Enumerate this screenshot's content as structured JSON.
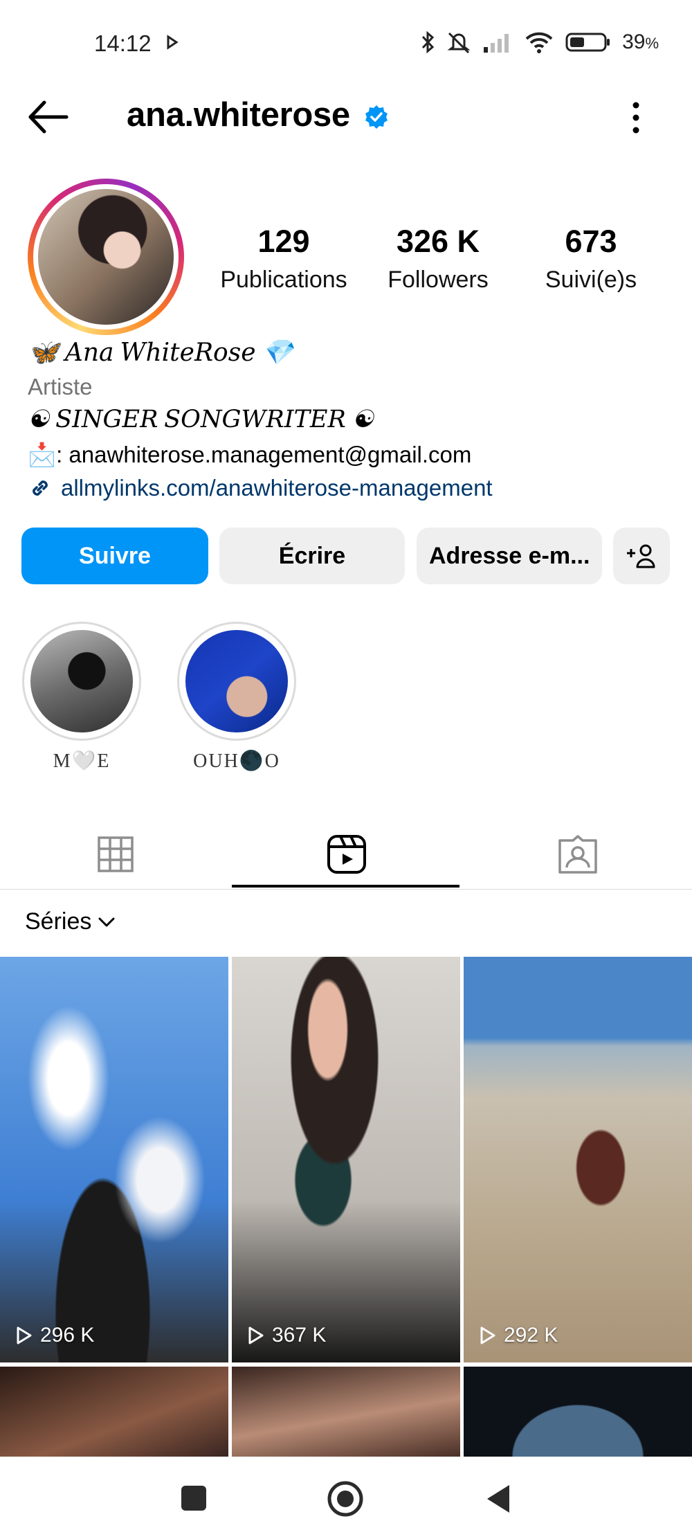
{
  "status_bar": {
    "time": "14:12",
    "battery_percent": "39",
    "battery_unit": "%",
    "icons": [
      "play-icon",
      "bluetooth-icon",
      "mute-icon",
      "signal-icon",
      "wifi-icon",
      "battery-icon"
    ]
  },
  "header": {
    "username": "ana.whiterose",
    "verified": true,
    "back_icon": "arrow-left-icon",
    "more_icon": "more-vertical-icon"
  },
  "stats": {
    "posts_count": "129",
    "posts_label": "Publications",
    "followers_count": "326 K",
    "followers_label": "Followers",
    "following_count": "673",
    "following_label": "Suivi(e)s"
  },
  "bio": {
    "name": "🦋 𝐴𝑛𝑎 𝑊ℎ𝑖𝑡𝑒𝑅𝑜𝑠𝑒 💎",
    "category": "Artiste",
    "line": "☯ 𝑆𝐼𝑁𝐺𝐸𝑅 𝑆𝑂𝑁𝐺𝑊𝑅𝐼𝑇𝐸𝑅 ☯",
    "email_line": "📩: anawhiterose.management@gmail.com",
    "link": "allmylinks.com/anawhiterose-management"
  },
  "actions": {
    "follow_label": "Suivre",
    "message_label": "Écrire",
    "email_label": "Adresse e-m...",
    "add_icon": "add-person-icon"
  },
  "highlights": [
    {
      "label": "M🤍E"
    },
    {
      "label": "OUH🌑O"
    }
  ],
  "tabs": {
    "active": "reels",
    "items": [
      "grid-icon",
      "reels-icon",
      "tagged-icon"
    ]
  },
  "filter": {
    "label": "Séries"
  },
  "posts": [
    {
      "views": "296 K"
    },
    {
      "views": "367 K"
    },
    {
      "views": "292 K"
    }
  ],
  "colors": {
    "accent": "#0095f6",
    "link": "#00376b",
    "secondary_text": "#737373",
    "button_bg": "#efefef",
    "verified": "#0095f6"
  }
}
